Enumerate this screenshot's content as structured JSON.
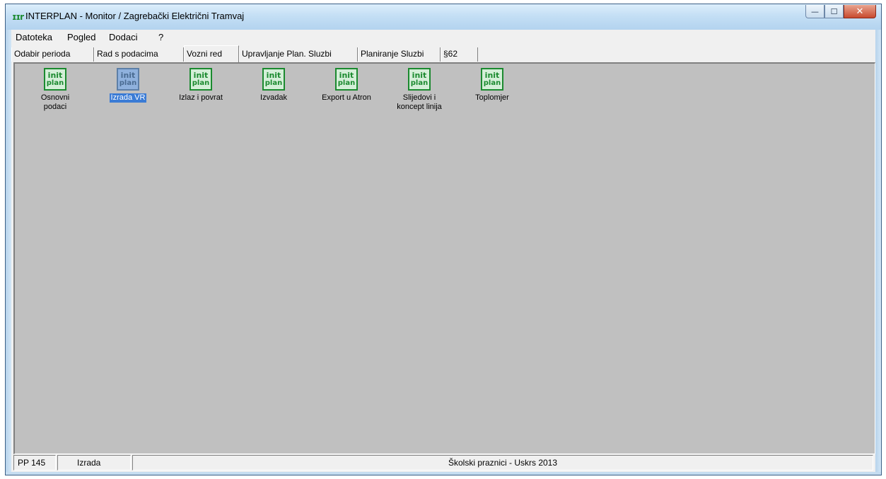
{
  "window": {
    "title": "INTERPLAN - Monitor / Zagrebački Električni Tramvaj",
    "app_icon": "interplan-logo-icon",
    "caption_buttons": {
      "minimize": "—",
      "maximize": "☐",
      "close": "✕"
    }
  },
  "menu": [
    "Datoteka",
    "Pogled",
    "Dodaci",
    "?"
  ],
  "tabs": [
    {
      "label": "Odabir perioda"
    },
    {
      "label": "Rad s podacima"
    },
    {
      "label": "Vozni red",
      "active": true
    },
    {
      "label": "Upravljanje Plan. Sluzbi"
    },
    {
      "label": "Planiranje Sluzbi"
    },
    {
      "label": "§62"
    }
  ],
  "icons": [
    {
      "logo_top": "init",
      "logo_bottom": "plan",
      "label_line1": "Osnovni",
      "label_line2": "podaci"
    },
    {
      "logo_top": "init",
      "logo_bottom": "plan",
      "label_line1": "Izrada VR",
      "label_line2": "",
      "selected": true
    },
    {
      "logo_top": "init",
      "logo_bottom": "plan",
      "label_line1": "Izlaz i povrat",
      "label_line2": ""
    },
    {
      "logo_top": "init",
      "logo_bottom": "plan",
      "label_line1": "Izvadak",
      "label_line2": ""
    },
    {
      "logo_top": "init",
      "logo_bottom": "plan",
      "label_line1": "Export u Atron",
      "label_line2": ""
    },
    {
      "logo_top": "init",
      "logo_bottom": "plan",
      "label_line1": "Slijedovi i",
      "label_line2": "koncept linija"
    },
    {
      "logo_top": "init",
      "logo_bottom": "plan",
      "label_line1": "Toplomjer",
      "label_line2": ""
    }
  ],
  "status": {
    "pp": "PP 145",
    "mode": "Izrada",
    "period": "Školski praznici - Uskrs 2013"
  },
  "colors": {
    "logo_green": "#1b8a2f",
    "workspace_gray": "#c0c0c0",
    "selection_blue": "#3a7bd5"
  }
}
